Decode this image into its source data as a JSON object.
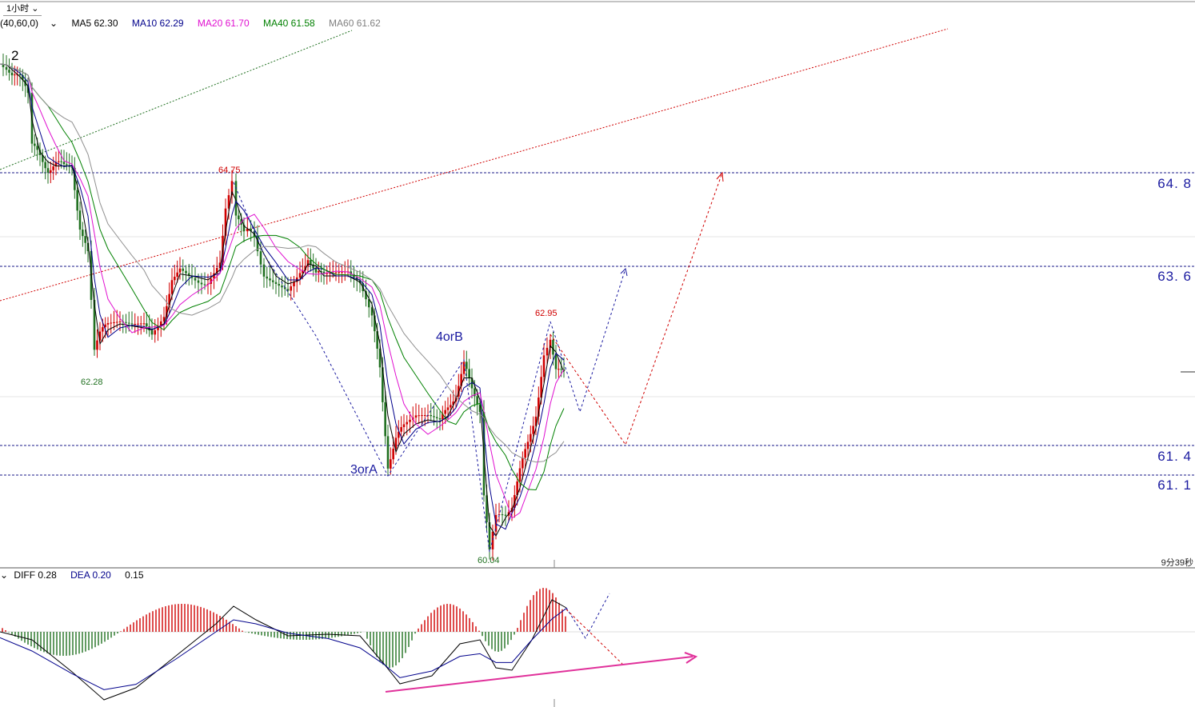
{
  "timeframe": {
    "label": "1小时",
    "chevron_icon": "chevron-down-icon"
  },
  "ma_legend": {
    "prefix": "40,60,0)",
    "items": [
      {
        "text": "MA5 62.30",
        "color": "#000000"
      },
      {
        "text": "MA10 62.29",
        "color": "#00008b"
      },
      {
        "text": "MA20 61.70",
        "color": "#e010d0"
      },
      {
        "text": "MA40 61.58",
        "color": "#008000"
      },
      {
        "text": "MA60 61.62",
        "color": "#808080"
      }
    ]
  },
  "macd_legend": {
    "items": [
      {
        "text": "DIFF 0.28",
        "color": "#000000"
      },
      {
        "text": "DEA 0.20",
        "color": "#00008b"
      },
      {
        "text": "0.15",
        "color": "#000000"
      }
    ]
  },
  "levels": {
    "l1": "64. 8",
    "l2": "63. 6",
    "l3": "61. 4",
    "l4": "61. 1"
  },
  "wave_labels": {
    "w2": "2",
    "w3": "3orA",
    "w4": "4orB"
  },
  "price_labels": {
    "p1": {
      "text": "64.75",
      "color": "#d00000"
    },
    "p2": {
      "text": "62.28",
      "color": "#207020"
    },
    "p3": {
      "text": "62.95",
      "color": "#d00000"
    },
    "p4": {
      "text": "60.04",
      "color": "#207020"
    }
  },
  "countdown": "9分39秒",
  "chart_data": {
    "type": "line",
    "timeframe": "1小时",
    "price_levels": [
      64.8,
      63.6,
      61.4,
      61.1
    ],
    "annotated_extremes": [
      {
        "label": "64.75",
        "kind": "high"
      },
      {
        "label": "62.28",
        "kind": "low"
      },
      {
        "label": "62.95",
        "kind": "high"
      },
      {
        "label": "60.04",
        "kind": "low"
      }
    ],
    "series": [
      {
        "name": "MA5",
        "value": 62.3
      },
      {
        "name": "MA10",
        "value": 62.29
      },
      {
        "name": "MA20",
        "value": 61.7
      },
      {
        "name": "MA40",
        "value": 61.58
      },
      {
        "name": "MA60",
        "value": 61.62
      },
      {
        "name": "DIFF",
        "value": 0.28
      },
      {
        "name": "DEA",
        "value": 0.2
      }
    ],
    "macd_hist_last": 0.15,
    "wave_labels": [
      "2",
      "3orA",
      "4orB"
    ]
  }
}
